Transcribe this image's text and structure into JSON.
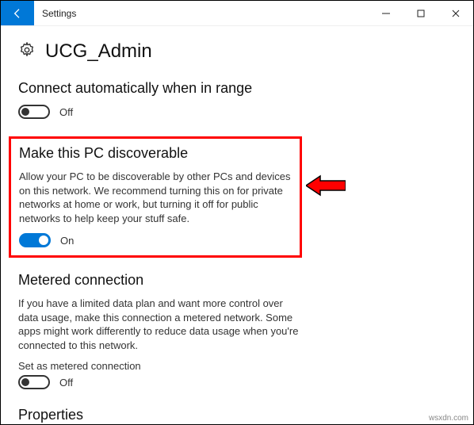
{
  "window": {
    "title": "Settings"
  },
  "page": {
    "title": "UCG_Admin"
  },
  "sections": {
    "auto_connect": {
      "title": "Connect automatically when in range",
      "toggle_state": "Off"
    },
    "discoverable": {
      "title": "Make this PC discoverable",
      "description": "Allow your PC to be discoverable by other PCs and devices on this network. We recommend turning this on for private networks at home or work, but turning it off for public networks to help keep your stuff safe.",
      "toggle_state": "On"
    },
    "metered": {
      "title": "Metered connection",
      "description": "If you have a limited data plan and want more control over data usage, make this connection a metered network. Some apps might work differently to reduce data usage when you're connected to this network.",
      "sublabel": "Set as metered connection",
      "toggle_state": "Off"
    },
    "properties": {
      "title": "Properties"
    }
  },
  "watermark": "wsxdn.com"
}
